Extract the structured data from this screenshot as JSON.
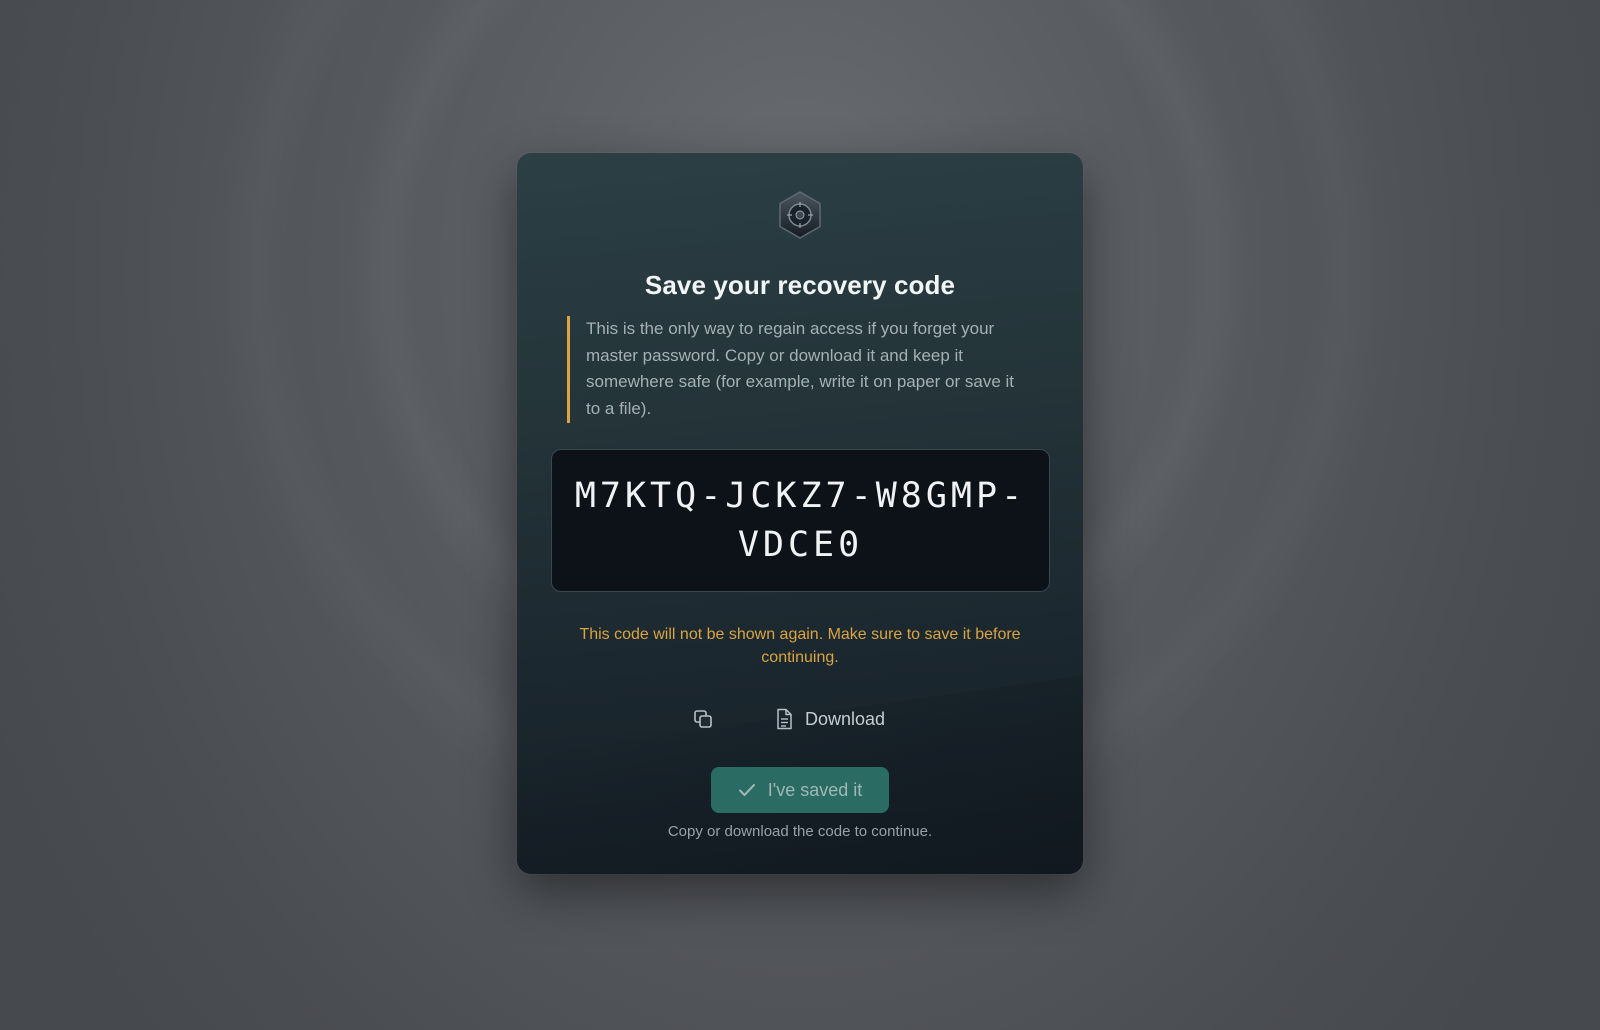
{
  "dialog": {
    "title": "Save your recovery code",
    "notice": "This is the only way to regain access if you forget your master password. Copy or download it and keep it somewhere safe (for example, write it on paper or save it to a file).",
    "recovery_code": {
      "line1": "M7KTQ-JCKZ7-W8GMP-",
      "line2": "VDCE0"
    },
    "warning": "This code will not be shown again. Make sure to save it before continuing.",
    "copy_icon": "copy-icon",
    "download_label": "Download",
    "download_icon": "document-icon",
    "confirm_label": "I've saved it",
    "confirm_icon": "check-icon",
    "confirm_enabled": false,
    "hint": "Copy or download the code to continue."
  },
  "colors": {
    "accent_warning": "#d9a441",
    "confirm_button": "#2a6b63",
    "card_top": "#2b3f45",
    "card_bottom": "#141c24",
    "background": "#5a5d62"
  }
}
